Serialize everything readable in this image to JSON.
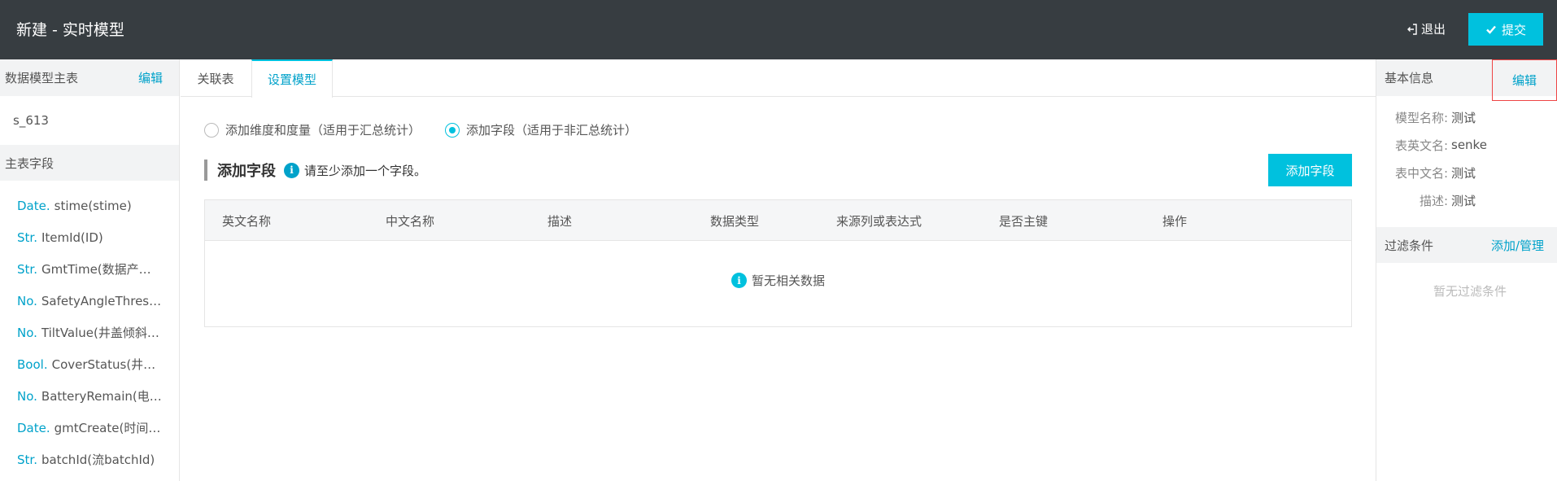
{
  "header": {
    "title": "新建 - 实时模型",
    "exit_label": "退出",
    "submit_label": "提交"
  },
  "left_panel": {
    "header_label": "数据模型主表",
    "edit_label": "编辑",
    "table_name": "s_613",
    "section_label": "主表字段",
    "fields": [
      {
        "type": "Date.",
        "name": "stime(stime)"
      },
      {
        "type": "Str.",
        "name": "ItemId(ID)"
      },
      {
        "type": "Str.",
        "name": "GmtTime(数据产生…"
      },
      {
        "type": "No.",
        "name": "SafetyAngleThresh…"
      },
      {
        "type": "No.",
        "name": "TiltValue(井盖倾斜度)"
      },
      {
        "type": "Bool.",
        "name": "CoverStatus(井盖…"
      },
      {
        "type": "No.",
        "name": "BatteryRemain(电池…"
      },
      {
        "type": "Date.",
        "name": "gmtCreate(时间戳…"
      },
      {
        "type": "Str.",
        "name": "batchId(流batchId)"
      }
    ]
  },
  "tabs": [
    {
      "label": "关联表"
    },
    {
      "label": "设置模型"
    }
  ],
  "main": {
    "radio_options": [
      {
        "label": "添加维度和度量（适用于汇总统计）",
        "checked": false
      },
      {
        "label": "添加字段（适用于非汇总统计）",
        "checked": true
      }
    ],
    "section_title": "添加字段",
    "section_hint": "请至少添加一个字段。",
    "add_button_label": "添加字段",
    "columns": [
      "英文名称",
      "中文名称",
      "描述",
      "数据类型",
      "来源列或表达式",
      "是否主键",
      "操作"
    ],
    "empty_text": "暂无相关数据"
  },
  "right_panel": {
    "header_label": "基本信息",
    "edit_label": "编辑",
    "info": [
      {
        "key": "模型名称:",
        "value": "测试"
      },
      {
        "key": "表英文名:",
        "value": "senke"
      },
      {
        "key": "表中文名:",
        "value": "测试"
      },
      {
        "key": "描述:",
        "value": "测试"
      }
    ],
    "filter_label": "过滤条件",
    "filter_action": "添加/管理",
    "filter_empty": "暂无过滤条件"
  },
  "colors": {
    "topbar": "#373d41",
    "accent": "#00c1de",
    "link": "#00a2ca",
    "highlight_border": "#ee4444"
  }
}
